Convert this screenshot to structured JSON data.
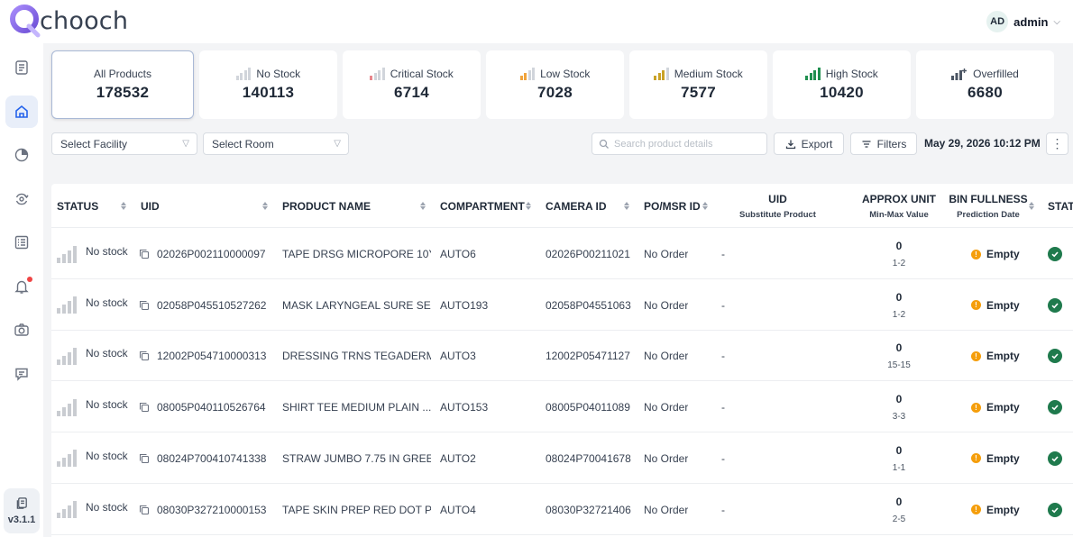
{
  "app": {
    "name": "chooch",
    "version": "v3.1.1"
  },
  "user": {
    "initials": "AD",
    "name": "admin"
  },
  "colors": {
    "brand": "#7c5cdb",
    "accent": "#1f7a4d",
    "empty": "#f59e0b",
    "critical": "#e8868c",
    "low": "#f0a43c",
    "medium": "#c9a227",
    "high": "#1f8f4f"
  },
  "sidebar": {
    "items": [
      {
        "icon": "report-icon"
      },
      {
        "icon": "home-icon",
        "active": true
      },
      {
        "icon": "pie-chart-icon"
      },
      {
        "icon": "sync-icon"
      },
      {
        "icon": "list-icon"
      },
      {
        "icon": "bell-icon",
        "badge": true
      },
      {
        "icon": "camera-icon"
      },
      {
        "icon": "chat-icon"
      }
    ]
  },
  "cards": [
    {
      "label": "All Products",
      "value": "178532"
    },
    {
      "label": "No Stock",
      "value": "140113"
    },
    {
      "label": "Critical Stock",
      "value": "6714"
    },
    {
      "label": "Low Stock",
      "value": "7028"
    },
    {
      "label": "Medium Stock",
      "value": "7577"
    },
    {
      "label": "High Stock",
      "value": "10420"
    },
    {
      "label": "Overfilled",
      "value": "6680"
    }
  ],
  "filters": {
    "facility": "Select Facility",
    "room": "Select Room",
    "search_placeholder": "Search product details",
    "export": "Export",
    "filters": "Filters",
    "datetime": "May 29, 2026 10:12 PM"
  },
  "table": {
    "headers": {
      "status": "STATUS",
      "uid": "UID",
      "product": "PRODUCT NAME",
      "compartment": "COMPARTMENT",
      "camera": "CAMERA ID",
      "po": "PO/MSR ID",
      "sub_uid": "UID",
      "sub_uid_sub": "Substitute Product",
      "approx": "APPROX UNIT",
      "approx_sub": "Min-Max Value",
      "bin": "BIN FULLNESS",
      "bin_sub": "Prediction Date",
      "stat": "STAT"
    },
    "rows": [
      {
        "status": "No stock",
        "uid": "02026P002110000097",
        "product": "TAPE DRSG MICROPORE 10Y...",
        "compartment": "AUTO6",
        "camera": "02026P00211021",
        "po": "No Order",
        "sub": "-",
        "units": "0",
        "range": "1-2",
        "fullness": "Empty"
      },
      {
        "status": "No stock",
        "uid": "02058P045510527262",
        "product": "MASK LARYNGEAL SURE SE...",
        "compartment": "AUTO193",
        "camera": "02058P04551063",
        "po": "No Order",
        "sub": "-",
        "units": "0",
        "range": "1-2",
        "fullness": "Empty"
      },
      {
        "status": "No stock",
        "uid": "12002P054710000313",
        "product": "DRESSING TRNS TEGADERM...",
        "compartment": "AUTO3",
        "camera": "12002P05471127",
        "po": "No Order",
        "sub": "-",
        "units": "0",
        "range": "15-15",
        "fullness": "Empty"
      },
      {
        "status": "No stock",
        "uid": "08005P040110526764",
        "product": "SHIRT TEE MEDIUM PLAIN ...",
        "compartment": "AUTO153",
        "camera": "08005P04011089",
        "po": "No Order",
        "sub": "-",
        "units": "0",
        "range": "3-3",
        "fullness": "Empty"
      },
      {
        "status": "No stock",
        "uid": "08024P700410741338",
        "product": "STRAW JUMBO 7.75 IN GREE...",
        "compartment": "AUTO2",
        "camera": "08024P70041678",
        "po": "No Order",
        "sub": "-",
        "units": "0",
        "range": "1-1",
        "fullness": "Empty"
      },
      {
        "status": "No stock",
        "uid": "08030P327210000153",
        "product": "TAPE SKIN PREP RED DOT P...",
        "compartment": "AUTO4",
        "camera": "08030P32721406",
        "po": "No Order",
        "sub": "-",
        "units": "0",
        "range": "2-5",
        "fullness": "Empty"
      }
    ]
  }
}
